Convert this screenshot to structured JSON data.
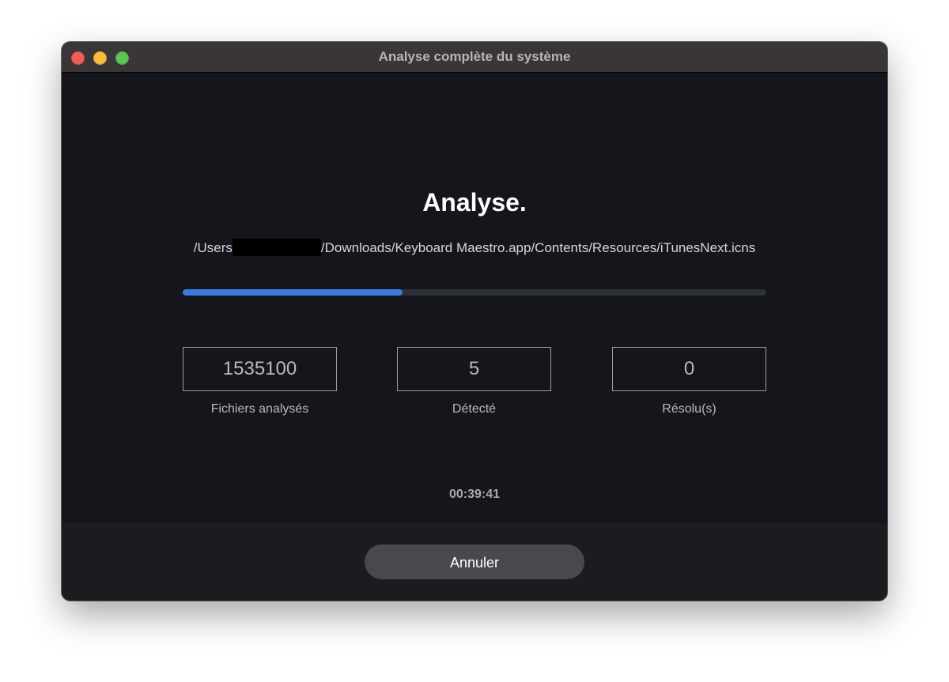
{
  "window": {
    "title": "Analyse complète du système"
  },
  "scan": {
    "heading": "Analyse",
    "heading_suffix": ".",
    "path_prefix": "/Users",
    "path_suffix": "/Downloads/Keyboard Maestro.app/Contents/Resources/iTunesNext.icns",
    "progress_fraction": 0.377,
    "progress_color": "#3a79e0"
  },
  "stats": [
    {
      "value": "1535100",
      "label": "Fichiers analysés"
    },
    {
      "value": "5",
      "label": "Détecté"
    },
    {
      "value": "0",
      "label": "Résolu(s)"
    }
  ],
  "timer": "00:39:41",
  "footer": {
    "cancel_label": "Annuler"
  },
  "colors": {
    "background": "#14161c",
    "titlebar": "#3a3536",
    "footer": "#1b1c20",
    "button": "#47494f",
    "close": "#ed5f56",
    "minimize": "#f5bd3f",
    "zoom": "#5fc353"
  }
}
